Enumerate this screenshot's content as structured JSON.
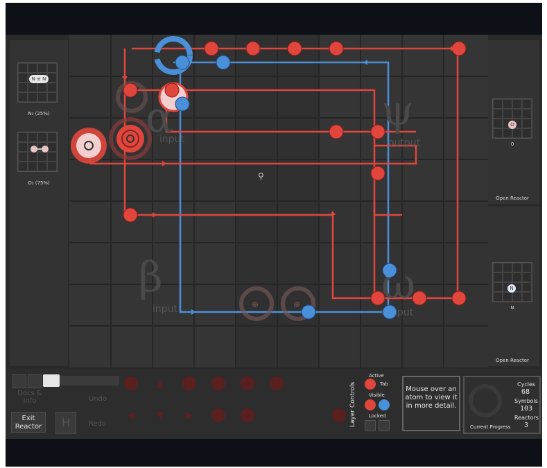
{
  "inputs": {
    "alpha": {
      "molecule": "N ≡ N",
      "label": "N₂ (25%)"
    },
    "beta": {
      "label": "O₂ (75%)"
    }
  },
  "outputs": {
    "psi": {
      "atom": "O",
      "count": "0",
      "open_label": "Open Reactor"
    },
    "omega": {
      "atom": "N",
      "count": "N",
      "open_label": "Open Reactor"
    }
  },
  "reactor": {
    "zones": {
      "alpha_sub": "input",
      "psi_sub": "output",
      "beta_symbol": "β",
      "beta_sub": "input",
      "omega_symbol": "ω",
      "omega_sub": "output"
    }
  },
  "left_controls": {
    "docs_label": "Docs & Info",
    "exit_label": "Exit Reactor",
    "h_label": "H"
  },
  "palette": {
    "undo": "Undo",
    "redo": "Redo"
  },
  "layer_controls": {
    "title": "Layer Controls",
    "active": "Active",
    "tab": "Tab",
    "visible": "Visible",
    "locked": "Locked"
  },
  "hint": "Mouse over an atom to view it in more detail.",
  "progress": {
    "cycles_label": "Cycles",
    "cycles": "68",
    "symbols_label": "Symbols",
    "symbols": "103",
    "reactors_label": "Reactors",
    "reactors": "3",
    "title": "Current Progress"
  },
  "colors": {
    "red": "#e0463c",
    "blue": "#4a90d9",
    "background": "#2a2a2a",
    "panel": "#333333"
  },
  "icons": [
    "flag-icon",
    "grab-icon",
    "bond-plus-icon",
    "bond-minus-icon",
    "sync-icon",
    "arrow-up-icon",
    "arrow-down-icon",
    "arrow-left-icon",
    "arrow-right-icon",
    "rotate-icon",
    "sensor-icon"
  ]
}
